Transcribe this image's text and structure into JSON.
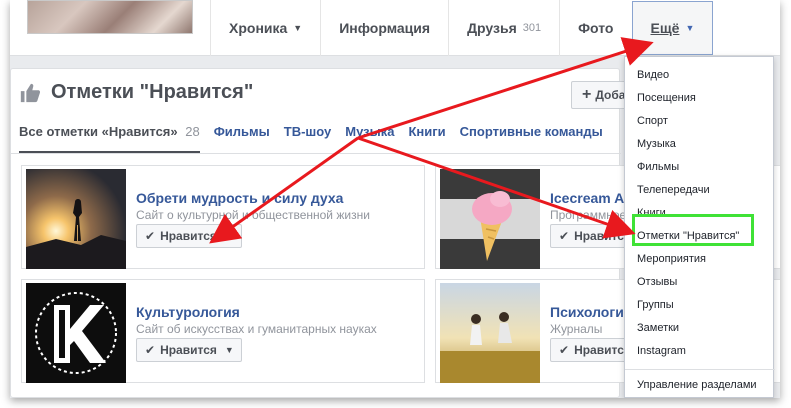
{
  "nav": {
    "tabs": [
      {
        "label": "Хроника",
        "caret": "▼"
      },
      {
        "label": "Информация"
      },
      {
        "label": "Друзья",
        "count": "301"
      },
      {
        "label": "Фото"
      },
      {
        "label": "Ещё",
        "caret": "▼",
        "active": true
      }
    ]
  },
  "section": {
    "title": "Отметки \"Нравится\"",
    "add_label": "Доба",
    "subtabs": [
      {
        "label": "Все отметки «Нравится»",
        "count": "28"
      },
      {
        "label": "Фильмы"
      },
      {
        "label": "ТВ-шоу"
      },
      {
        "label": "Музыка"
      },
      {
        "label": "Книги"
      },
      {
        "label": "Спортивные команды"
      }
    ],
    "like_label": "Нравится",
    "cards": [
      {
        "name": "Обрети мудрость и силу духа",
        "desc": "Сайт о культурной и общественной жизни"
      },
      {
        "name": "Icecream A",
        "desc": "Программное"
      },
      {
        "name": "Культурология",
        "desc": "Сайт об искусствах и гуманитарных науках"
      },
      {
        "name": "Психологи",
        "desc": "Журналы"
      }
    ]
  },
  "dropdown": {
    "items": [
      "Видео",
      "Посещения",
      "Спорт",
      "Музыка",
      "Фильмы",
      "Телепередачи",
      "Книги",
      "Отметки \"Нравится\"",
      "Мероприятия",
      "Отзывы",
      "Группы",
      "Заметки",
      "Instagram"
    ],
    "footer": "Управление разделами"
  },
  "colors": {
    "accent_blue": "#4267b2",
    "link_blue": "#365899",
    "annotation_red": "#e8191e",
    "highlight_green": "#3fe236"
  }
}
